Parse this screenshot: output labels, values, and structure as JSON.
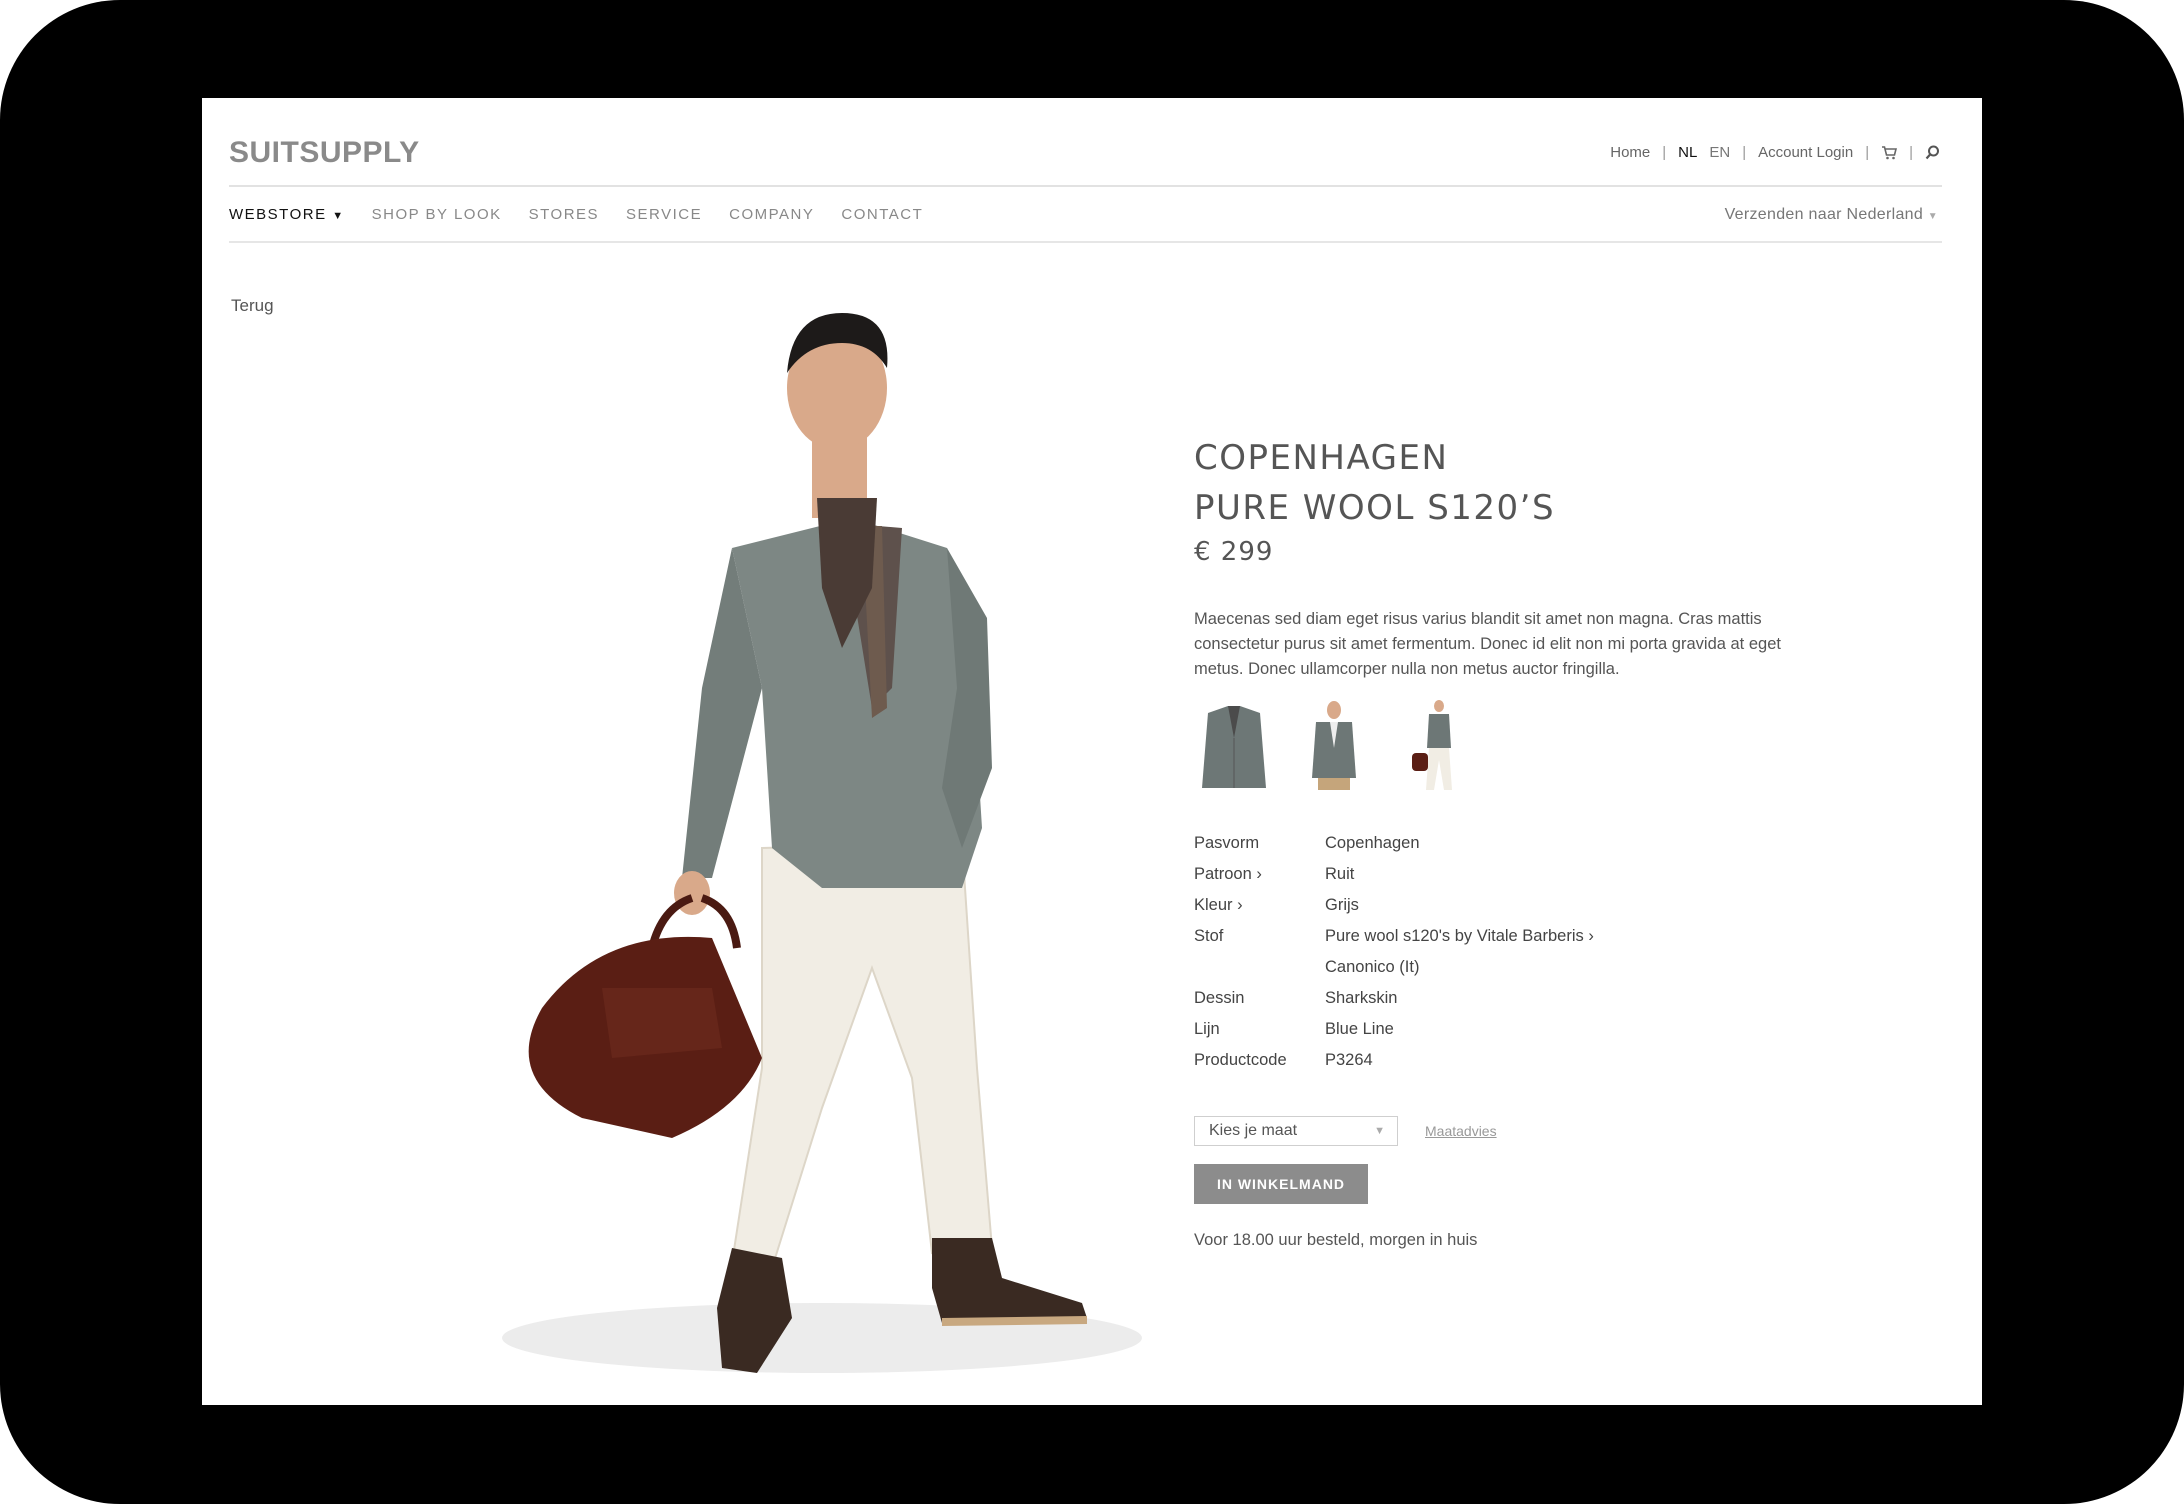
{
  "brand": {
    "logo": "SUITSUPPLY"
  },
  "utility_nav": {
    "home": "Home",
    "lang_nl": "NL",
    "lang_en": "EN",
    "account": "Account Login"
  },
  "main_nav": {
    "items": [
      "WEBSTORE",
      "SHOP BY LOOK",
      "STORES",
      "SERVICE",
      "COMPANY",
      "CONTACT"
    ],
    "active": "WEBSTORE",
    "shipping": "Verzenden naar Nederland"
  },
  "back_link": "Terug",
  "product": {
    "title_line1": "COPENHAGEN",
    "title_line2": "PURE WOOL S120’S",
    "price": "€ 299",
    "description": "Maecenas sed diam eget risus varius blandit sit amet non magna. Cras mattis consectetur purus sit amet fermentum. Donec id elit non mi porta gravida at eget metus. Donec ullamcorper nulla non metus auctor fringilla.",
    "specs": [
      {
        "key": "Pasvorm",
        "value": "Copenhagen"
      },
      {
        "key": "Patroon ›",
        "value": "Ruit"
      },
      {
        "key": "Kleur ›",
        "value": "Grijs"
      },
      {
        "key": "Stof",
        "value": "Pure wool s120's by Vitale Barberis  ›"
      },
      {
        "key": "",
        "value": "Canonico (It)"
      },
      {
        "key": "Dessin",
        "value": "Sharkskin"
      },
      {
        "key": "Lijn",
        "value": "Blue Line"
      },
      {
        "key": "Productcode",
        "value": "P3264"
      }
    ],
    "size_placeholder": "Kies je maat",
    "size_advice": "Maatadvies",
    "add_to_cart": "IN WINKELMAND",
    "delivery_note": "Voor 18.00 uur besteld, morgen in huis"
  },
  "colors": {
    "jacket": "#7d8784",
    "trousers": "#f1ede4",
    "bag": "#5a1e14",
    "button": "#8c8c8c"
  }
}
